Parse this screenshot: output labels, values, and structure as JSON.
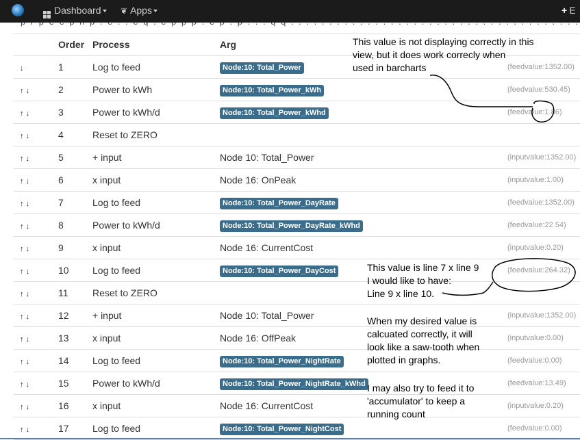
{
  "navbar": {
    "dashboard_label": "Dashboard",
    "apps_label": "Apps",
    "extra_label": "E"
  },
  "table": {
    "headers": [
      "Order",
      "Process",
      "Arg"
    ],
    "rows": [
      {
        "order": "1",
        "up": false,
        "down": true,
        "process": "Log to feed",
        "arg": "Node:10: Total_Power",
        "arg_is_feed": true,
        "value": "(feedvalue:1352.00)"
      },
      {
        "order": "2",
        "up": true,
        "down": true,
        "process": "Power to kWh",
        "arg": "Node:10: Total_Power_kWh",
        "arg_is_feed": true,
        "value": "(feedvalue:530.45)"
      },
      {
        "order": "3",
        "up": true,
        "down": true,
        "process": "Power to kWh/d",
        "arg": "Node:10: Total_Power_kWhd",
        "arg_is_feed": true,
        "value": "(feedvalue:1.86)"
      },
      {
        "order": "4",
        "up": true,
        "down": true,
        "process": "Reset to ZERO",
        "arg": "",
        "arg_is_feed": false,
        "value": ""
      },
      {
        "order": "5",
        "up": true,
        "down": true,
        "process": "+ input",
        "arg": "Node 10: Total_Power",
        "arg_is_feed": false,
        "value": "(inputvalue:1352.00)"
      },
      {
        "order": "6",
        "up": true,
        "down": true,
        "process": "x input",
        "arg": "Node 16: OnPeak",
        "arg_is_feed": false,
        "value": "(inputvalue:1.00)"
      },
      {
        "order": "7",
        "up": true,
        "down": true,
        "process": "Log to feed",
        "arg": "Node:10: Total_Power_DayRate",
        "arg_is_feed": true,
        "value": "(feedvalue:1352.00)"
      },
      {
        "order": "8",
        "up": true,
        "down": true,
        "process": "Power to kWh/d",
        "arg": "Node:10: Total_Power_DayRate_kWhd",
        "arg_is_feed": true,
        "value": "(feedvalue:22.54)"
      },
      {
        "order": "9",
        "up": true,
        "down": true,
        "process": "x input",
        "arg": "Node 16: CurrentCost",
        "arg_is_feed": false,
        "value": "(inputvalue:0.20)"
      },
      {
        "order": "10",
        "up": true,
        "down": true,
        "process": "Log to feed",
        "arg": "Node:10: Total_Power_DayCost",
        "arg_is_feed": true,
        "value": "(feedvalue:264.32)"
      },
      {
        "order": "11",
        "up": true,
        "down": true,
        "process": "Reset to ZERO",
        "arg": "",
        "arg_is_feed": false,
        "value": ""
      },
      {
        "order": "12",
        "up": true,
        "down": true,
        "process": "+ input",
        "arg": "Node 10: Total_Power",
        "arg_is_feed": false,
        "value": "(inputvalue:1352.00)"
      },
      {
        "order": "13",
        "up": true,
        "down": true,
        "process": "x input",
        "arg": "Node 16: OffPeak",
        "arg_is_feed": false,
        "value": "(inputvalue:0.00)"
      },
      {
        "order": "14",
        "up": true,
        "down": true,
        "process": "Log to feed",
        "arg": "Node:10: Total_Power_NightRate",
        "arg_is_feed": true,
        "value": "(feedvalue:0.00)"
      },
      {
        "order": "15",
        "up": true,
        "down": true,
        "process": "Power to kWh/d",
        "arg": "Node:10: Total_Power_NightRate_kWhd",
        "arg_is_feed": true,
        "value": "(feedvalue:13.49)"
      },
      {
        "order": "16",
        "up": true,
        "down": true,
        "process": "x input",
        "arg": "Node 16: CurrentCost",
        "arg_is_feed": false,
        "value": "(inputvalue:0.20)"
      },
      {
        "order": "17",
        "up": true,
        "down": true,
        "process": "Log to feed",
        "arg": "Node:10: Total_Power_NightCost",
        "arg_is_feed": true,
        "value": "(feedvalue:0.00)"
      }
    ]
  },
  "annotations": {
    "note1": [
      "This value is not displaying correctly in this",
      "view, but it does work correcly when",
      "used in barcharts"
    ],
    "note2": [
      "This value is line 7 x line 9",
      "I would like to have:",
      "Line 9 x line 10."
    ],
    "note3": [
      "When my desired value is",
      "calcuated correctly, it will",
      "look like a saw-tooth when",
      "plotted in graphs."
    ],
    "note4": [
      "I may also try to feed it to",
      "'accumulator' to keep a",
      "running count"
    ]
  },
  "icons": {
    "up": "arrow-up-icon",
    "down": "arrow-down-icon"
  },
  "colors": {
    "navbar": "#1b1b1b",
    "feed_label": "#3a6d8c"
  }
}
